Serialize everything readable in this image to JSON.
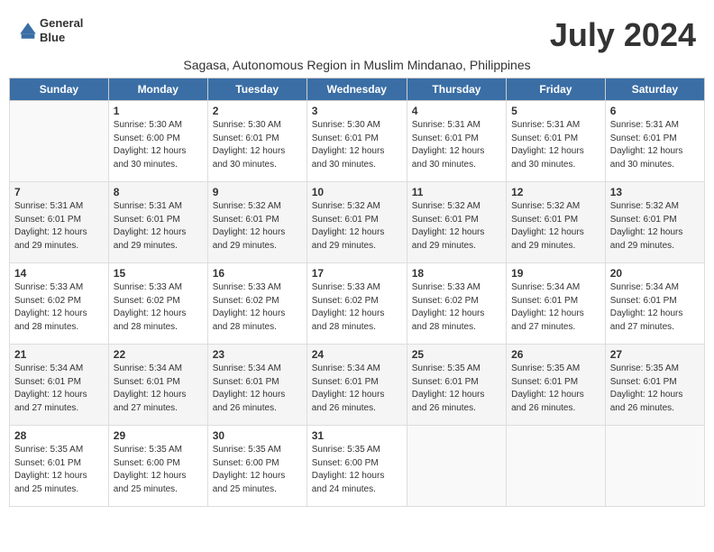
{
  "logo": {
    "line1": "General",
    "line2": "Blue"
  },
  "title": "July 2024",
  "subtitle": "Sagasa, Autonomous Region in Muslim Mindanao, Philippines",
  "days_of_week": [
    "Sunday",
    "Monday",
    "Tuesday",
    "Wednesday",
    "Thursday",
    "Friday",
    "Saturday"
  ],
  "weeks": [
    [
      {
        "day": "",
        "info": ""
      },
      {
        "day": "1",
        "info": "Sunrise: 5:30 AM\nSunset: 6:00 PM\nDaylight: 12 hours\nand 30 minutes."
      },
      {
        "day": "2",
        "info": "Sunrise: 5:30 AM\nSunset: 6:01 PM\nDaylight: 12 hours\nand 30 minutes."
      },
      {
        "day": "3",
        "info": "Sunrise: 5:30 AM\nSunset: 6:01 PM\nDaylight: 12 hours\nand 30 minutes."
      },
      {
        "day": "4",
        "info": "Sunrise: 5:31 AM\nSunset: 6:01 PM\nDaylight: 12 hours\nand 30 minutes."
      },
      {
        "day": "5",
        "info": "Sunrise: 5:31 AM\nSunset: 6:01 PM\nDaylight: 12 hours\nand 30 minutes."
      },
      {
        "day": "6",
        "info": "Sunrise: 5:31 AM\nSunset: 6:01 PM\nDaylight: 12 hours\nand 30 minutes."
      }
    ],
    [
      {
        "day": "7",
        "info": "Sunrise: 5:31 AM\nSunset: 6:01 PM\nDaylight: 12 hours\nand 29 minutes."
      },
      {
        "day": "8",
        "info": "Sunrise: 5:31 AM\nSunset: 6:01 PM\nDaylight: 12 hours\nand 29 minutes."
      },
      {
        "day": "9",
        "info": "Sunrise: 5:32 AM\nSunset: 6:01 PM\nDaylight: 12 hours\nand 29 minutes."
      },
      {
        "day": "10",
        "info": "Sunrise: 5:32 AM\nSunset: 6:01 PM\nDaylight: 12 hours\nand 29 minutes."
      },
      {
        "day": "11",
        "info": "Sunrise: 5:32 AM\nSunset: 6:01 PM\nDaylight: 12 hours\nand 29 minutes."
      },
      {
        "day": "12",
        "info": "Sunrise: 5:32 AM\nSunset: 6:01 PM\nDaylight: 12 hours\nand 29 minutes."
      },
      {
        "day": "13",
        "info": "Sunrise: 5:32 AM\nSunset: 6:01 PM\nDaylight: 12 hours\nand 29 minutes."
      }
    ],
    [
      {
        "day": "14",
        "info": "Sunrise: 5:33 AM\nSunset: 6:02 PM\nDaylight: 12 hours\nand 28 minutes."
      },
      {
        "day": "15",
        "info": "Sunrise: 5:33 AM\nSunset: 6:02 PM\nDaylight: 12 hours\nand 28 minutes."
      },
      {
        "day": "16",
        "info": "Sunrise: 5:33 AM\nSunset: 6:02 PM\nDaylight: 12 hours\nand 28 minutes."
      },
      {
        "day": "17",
        "info": "Sunrise: 5:33 AM\nSunset: 6:02 PM\nDaylight: 12 hours\nand 28 minutes."
      },
      {
        "day": "18",
        "info": "Sunrise: 5:33 AM\nSunset: 6:02 PM\nDaylight: 12 hours\nand 28 minutes."
      },
      {
        "day": "19",
        "info": "Sunrise: 5:34 AM\nSunset: 6:01 PM\nDaylight: 12 hours\nand 27 minutes."
      },
      {
        "day": "20",
        "info": "Sunrise: 5:34 AM\nSunset: 6:01 PM\nDaylight: 12 hours\nand 27 minutes."
      }
    ],
    [
      {
        "day": "21",
        "info": "Sunrise: 5:34 AM\nSunset: 6:01 PM\nDaylight: 12 hours\nand 27 minutes."
      },
      {
        "day": "22",
        "info": "Sunrise: 5:34 AM\nSunset: 6:01 PM\nDaylight: 12 hours\nand 27 minutes."
      },
      {
        "day": "23",
        "info": "Sunrise: 5:34 AM\nSunset: 6:01 PM\nDaylight: 12 hours\nand 26 minutes."
      },
      {
        "day": "24",
        "info": "Sunrise: 5:34 AM\nSunset: 6:01 PM\nDaylight: 12 hours\nand 26 minutes."
      },
      {
        "day": "25",
        "info": "Sunrise: 5:35 AM\nSunset: 6:01 PM\nDaylight: 12 hours\nand 26 minutes."
      },
      {
        "day": "26",
        "info": "Sunrise: 5:35 AM\nSunset: 6:01 PM\nDaylight: 12 hours\nand 26 minutes."
      },
      {
        "day": "27",
        "info": "Sunrise: 5:35 AM\nSunset: 6:01 PM\nDaylight: 12 hours\nand 26 minutes."
      }
    ],
    [
      {
        "day": "28",
        "info": "Sunrise: 5:35 AM\nSunset: 6:01 PM\nDaylight: 12 hours\nand 25 minutes."
      },
      {
        "day": "29",
        "info": "Sunrise: 5:35 AM\nSunset: 6:00 PM\nDaylight: 12 hours\nand 25 minutes."
      },
      {
        "day": "30",
        "info": "Sunrise: 5:35 AM\nSunset: 6:00 PM\nDaylight: 12 hours\nand 25 minutes."
      },
      {
        "day": "31",
        "info": "Sunrise: 5:35 AM\nSunset: 6:00 PM\nDaylight: 12 hours\nand 24 minutes."
      },
      {
        "day": "",
        "info": ""
      },
      {
        "day": "",
        "info": ""
      },
      {
        "day": "",
        "info": ""
      }
    ]
  ]
}
